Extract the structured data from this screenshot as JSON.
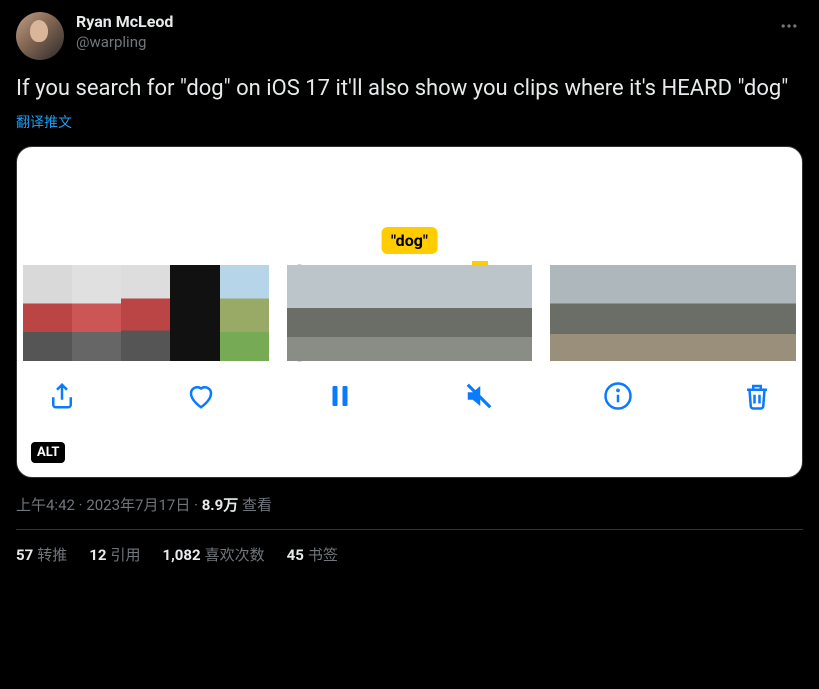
{
  "author": {
    "display_name": "Ryan McLeod",
    "handle": "@warpling"
  },
  "tweet_text": "If you search for \"dog\" on iOS 17 it'll also show you clips where it's HEARD \"dog\"",
  "translate_label": "翻译推文",
  "media": {
    "badge_text": "\"dog\"",
    "alt_label": "ALT"
  },
  "meta": {
    "time": "上午4:42",
    "dot1": " · ",
    "date": "2023年7月17日",
    "dot2": " · ",
    "views_number": "8.9万",
    "views_label": " 查看"
  },
  "stats": {
    "retweets_n": "57",
    "retweets_label": "转推",
    "quotes_n": "12",
    "quotes_label": "引用",
    "likes_n": "1,082",
    "likes_label": "喜欢次数",
    "bookmarks_n": "45",
    "bookmarks_label": "书签"
  }
}
